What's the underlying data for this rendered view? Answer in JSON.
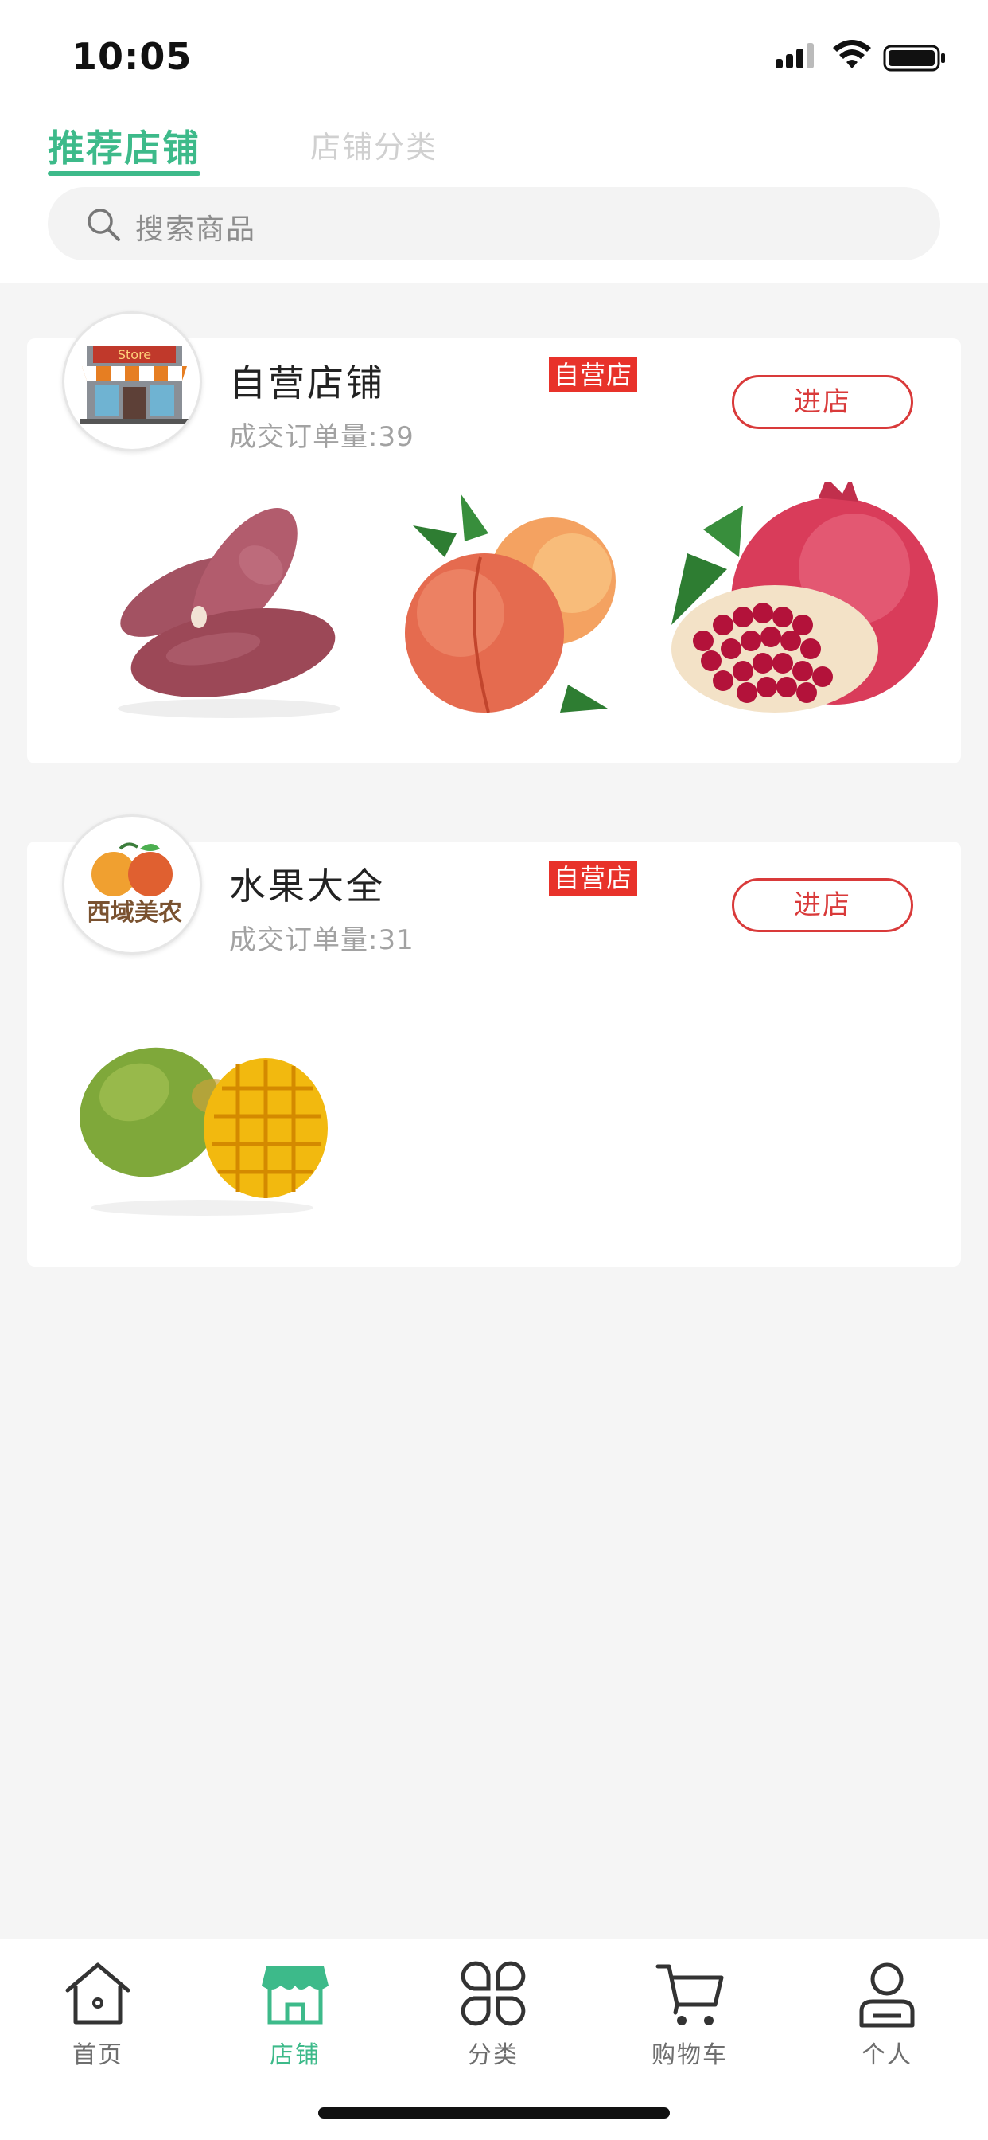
{
  "status_bar": {
    "time": "10:05"
  },
  "header": {
    "tabs": [
      {
        "label": "推荐店铺",
        "active": true
      },
      {
        "label": "店铺分类",
        "active": false
      }
    ],
    "search": {
      "placeholder": "搜索商品"
    }
  },
  "stores": [
    {
      "name": "自营店铺",
      "badge": "自营店",
      "orders": "成交订单量:39",
      "enter_label": "进店",
      "logo_text": "Store",
      "products": [
        "sweet-potato",
        "peach",
        "pomegranate"
      ]
    },
    {
      "name": "水果大全",
      "badge": "自营店",
      "orders": "成交订单量:31",
      "enter_label": "进店",
      "logo_text": "西域美农",
      "products": [
        "mango"
      ]
    }
  ],
  "tabbar": {
    "items": [
      {
        "label": "首页",
        "icon": "home-icon",
        "active": false
      },
      {
        "label": "店铺",
        "icon": "store-icon",
        "active": true
      },
      {
        "label": "分类",
        "icon": "category-icon",
        "active": false
      },
      {
        "label": "购物车",
        "icon": "cart-icon",
        "active": false
      },
      {
        "label": "个人",
        "icon": "profile-icon",
        "active": false
      }
    ]
  },
  "colors": {
    "accent": "#3dba8a",
    "badge": "#e8322a",
    "enter_button": "#d93a3a",
    "page_background": "#f5f5f5"
  }
}
